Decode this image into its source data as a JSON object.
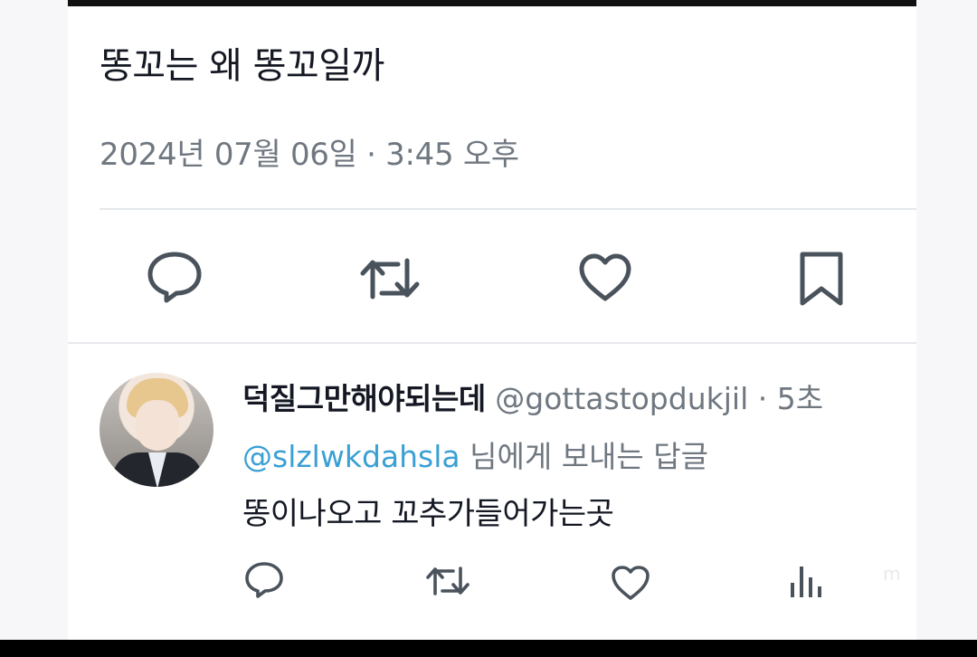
{
  "tweet": {
    "text": "똥꼬는 왜 똥꼬일까",
    "date": "2024년 07월 06일",
    "separator": "·",
    "time": "3:45 오후"
  },
  "actions": {
    "reply_icon": "speech-bubble",
    "retweet_icon": "retweet-arrows",
    "like_icon": "heart-outline",
    "bookmark_icon": "bookmark-outline"
  },
  "reply": {
    "display_name": "덕질그만해야되는데",
    "handle": "@gottastopdukjil",
    "separator": "·",
    "time": "5초",
    "replying_to_mention": "@slzlwkdahsla",
    "replying_to_suffix": "님에게 보내는 답글",
    "text": "똥이나오고 꼬추가들어가는곳",
    "actions": [
      "speech-bubble",
      "retweet-arrows",
      "heart-outline",
      "bar-chart"
    ]
  },
  "colors": {
    "text": "#141823",
    "muted": "#6f7780",
    "mention": "#3aa0d4",
    "icon": "#4a535c",
    "divider": "#e6e9ec"
  },
  "watermark": "m"
}
